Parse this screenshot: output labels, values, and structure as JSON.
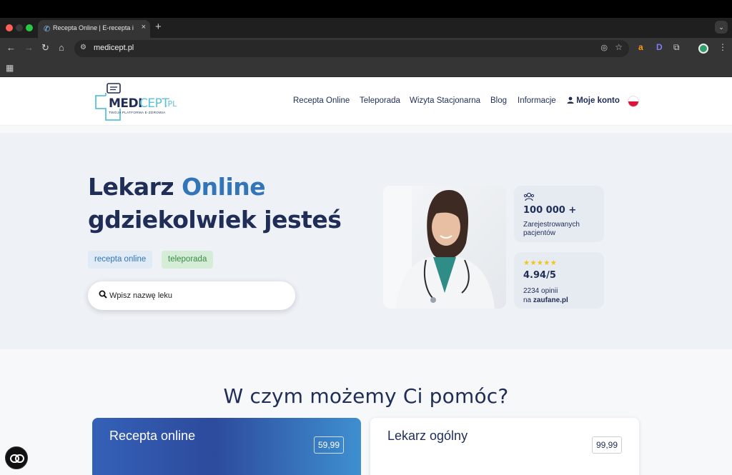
{
  "browser": {
    "tab_title": "Recepta Online | E-recepta i Teleporada",
    "tab_close": "×",
    "new_tab": "+",
    "url": "medicept.pl",
    "nav": {
      "back": "←",
      "forward": "→",
      "reload": "↻",
      "home": "⌂"
    },
    "extensions": [
      "a",
      "D"
    ]
  },
  "site": {
    "logo": {
      "wordmark_dark": "MEDI",
      "wordmark_light": "CEPT",
      "suffix": ".PL",
      "tagline": "TWOJA PLATFORMA E-ZDROWIA"
    },
    "nav": [
      {
        "label": "Recepta Online"
      },
      {
        "label": "Teleporada"
      },
      {
        "label": "Wizyta Stacjonarna"
      },
      {
        "label": "Blog"
      },
      {
        "label": "Informacje"
      },
      {
        "label": "Moje konto"
      }
    ]
  },
  "hero": {
    "title_part1": "Lekarz ",
    "title_accent": "Online",
    "title_line2": "gdziekolwiek jesteś",
    "tags": [
      {
        "label": "recepta online"
      },
      {
        "label": "teleporada"
      }
    ],
    "search_placeholder": "Wpisz nazwę leku",
    "stats": {
      "patients_value": "100 000 +",
      "patients_label_line1": "Zarejestrowanych",
      "patients_label_line2": "pacjentów",
      "stars": "★★★★★",
      "rating": "4.94/5",
      "reviews_line1": "2234 opinii",
      "reviews_prefix": "na ",
      "reviews_source": "zaufane.pl"
    }
  },
  "services": {
    "title": "W czym możemy Ci pomóc?",
    "items": [
      {
        "title": "Recepta online",
        "price": "59,99"
      },
      {
        "title": "Lekarz ogólny",
        "price": "99,99"
      }
    ]
  },
  "colors": {
    "navy": "#1f2d57",
    "accent": "#3275b8",
    "tag_green": "#3c8a4a"
  }
}
